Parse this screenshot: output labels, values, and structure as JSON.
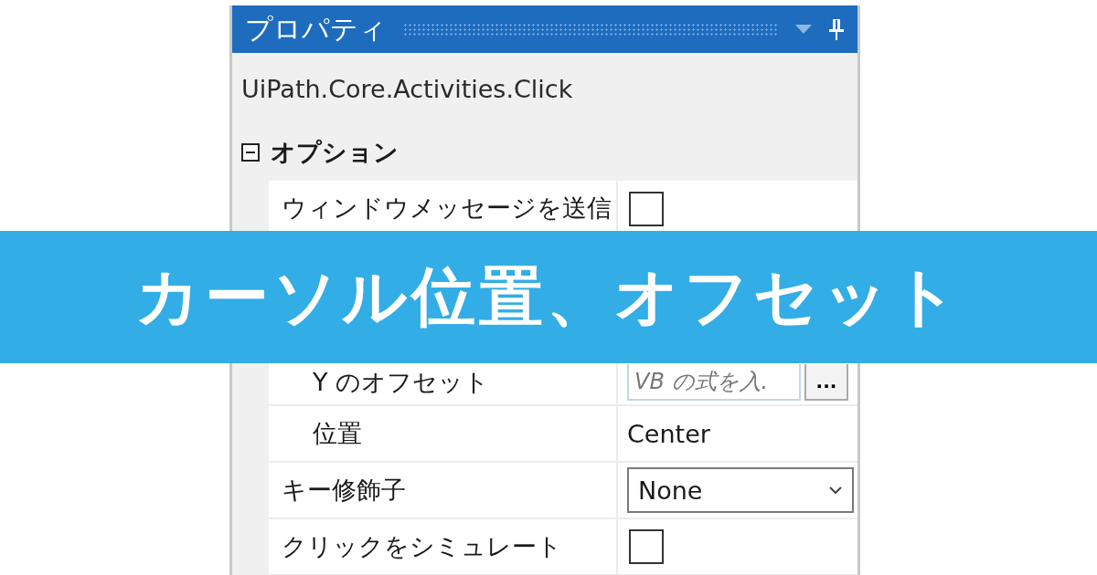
{
  "panel": {
    "title": "プロパティ",
    "subtitle": "UiPath.Core.Activities.Click",
    "categories": [
      {
        "label": "オプション",
        "expanded": true,
        "children": [
          {
            "kind": "checkbox",
            "label": "ウィンドウメッセージを送信",
            "checked": false,
            "selected": false
          },
          {
            "kind": "group",
            "expanded": true,
            "children": [
              {
                "kind": "expression",
                "label": "Y のオフセット",
                "placeholder": "VB の式を入.",
                "button": "...",
                "selected": false
              },
              {
                "kind": "text",
                "label": "位置",
                "value": "Center",
                "selected": false
              }
            ]
          },
          {
            "kind": "dropdown",
            "label": "キー修飾子",
            "value": "None",
            "selected": false
          },
          {
            "kind": "checkbox",
            "label": "クリックをシミュレート",
            "checked": false,
            "selected": false
          }
        ]
      }
    ]
  },
  "banner": {
    "text": "カーソル位置、オフセット"
  }
}
